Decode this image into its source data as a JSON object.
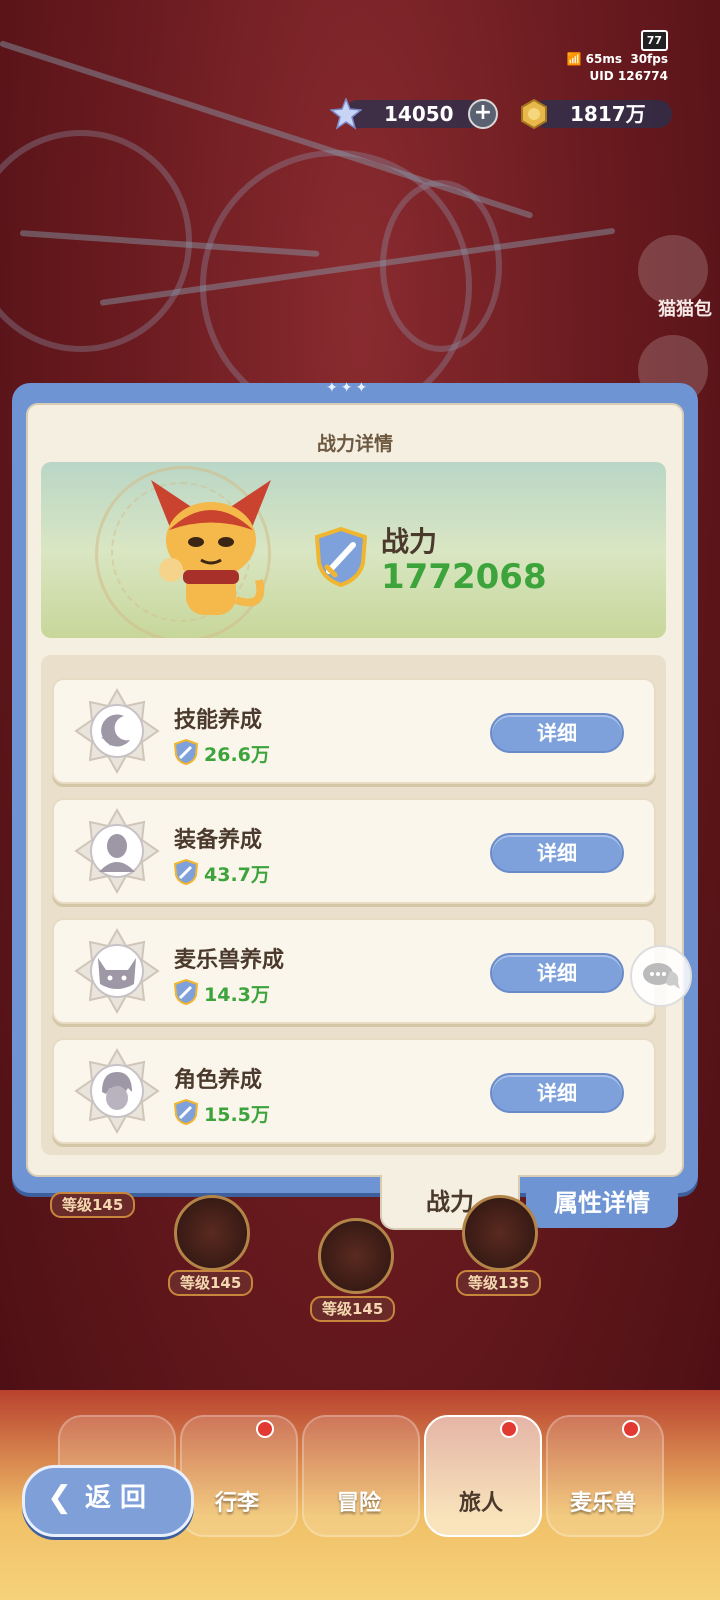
{
  "status": {
    "battery": "77",
    "ping": "65ms",
    "fps": "30fps",
    "uid": "UID 126774"
  },
  "currency": {
    "stars": "14050",
    "gold": "1817万"
  },
  "side": {
    "cat_bag_label": "猫猫包"
  },
  "panel": {
    "title": "战力详情",
    "power_label": "战力",
    "power_value": "1772068",
    "items": [
      {
        "name": "技能养成",
        "value": "26.6万",
        "button": "详细",
        "icon": "moon-star-icon"
      },
      {
        "name": "装备养成",
        "value": "43.7万",
        "button": "详细",
        "icon": "equipment-icon"
      },
      {
        "name": "麦乐兽养成",
        "value": "14.3万",
        "button": "详细",
        "icon": "beast-icon"
      },
      {
        "name": "角色养成",
        "value": "15.5万",
        "button": "详细",
        "icon": "character-icon"
      }
    ]
  },
  "tabs": {
    "active": "战力",
    "other": "属性详情"
  },
  "levels": [
    "等级145",
    "等级145",
    "等级145",
    "等级135"
  ],
  "nav": {
    "back": "返 回",
    "items": [
      "行李",
      "冒险",
      "旅人",
      "麦乐兽"
    ]
  },
  "colors": {
    "accent_blue": "#6e94d4",
    "power_green": "#3da43b",
    "panel_bg": "#f5efe2"
  }
}
